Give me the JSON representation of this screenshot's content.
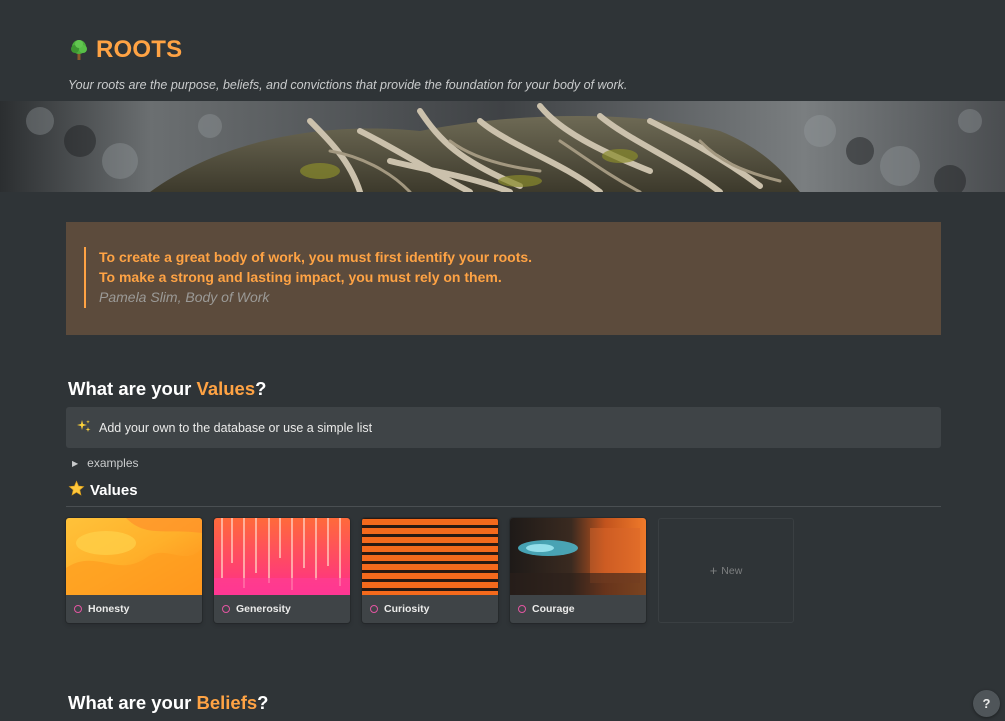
{
  "page": {
    "title": "ROOTS",
    "subtitle": "Your roots are the purpose, beliefs, and convictions that provide the foundation for your body of work.",
    "icon": "tree-icon"
  },
  "quote": {
    "line1": "To create a great body of work, you must first identify your roots.",
    "line2": "To make a strong and lasting impact, you must rely on them.",
    "author": "Pamela Slim, Body of Work"
  },
  "values_section": {
    "heading_prefix": "What are your ",
    "heading_accent": "Values",
    "heading_suffix": "?",
    "callout_icon": "sparkles-icon",
    "callout_text": "Add your own to the database or use a simple list",
    "toggle_label": "examples",
    "database_icon": "star-icon",
    "database_title": "Values",
    "cards": [
      {
        "label": "Honesty",
        "cover": "orange-yellow-gradient"
      },
      {
        "label": "Generosity",
        "cover": "pink-red-streaks"
      },
      {
        "label": "Curiosity",
        "cover": "orange-stripes"
      },
      {
        "label": "Courage",
        "cover": "dark-orange-blur"
      }
    ],
    "new_label": "New"
  },
  "beliefs_section": {
    "heading_prefix": "What are your ",
    "heading_accent": "Beliefs",
    "heading_suffix": "?"
  },
  "help_label": "?",
  "colors": {
    "background": "#2f3437",
    "accent": "#ffa344",
    "quote_background": "#5c4b3c",
    "callout_background": "#3f4447",
    "status_ring": "#e255a1"
  }
}
